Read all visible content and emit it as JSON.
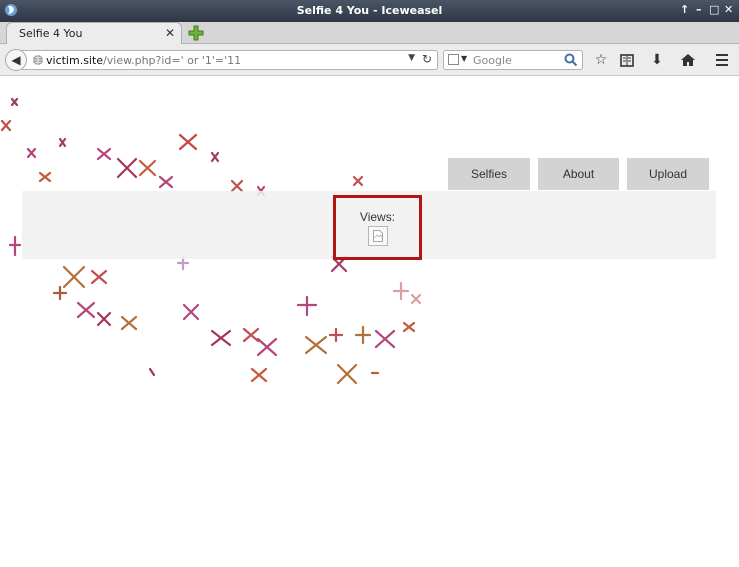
{
  "window": {
    "title": "Selfie 4 You - Iceweasel",
    "controls": [
      "↑",
      "–",
      "□",
      "✕"
    ]
  },
  "tabs": [
    {
      "label": "Selfie 4 You",
      "close_glyph": "✕"
    }
  ],
  "navbar": {
    "url_host": "victim.site",
    "url_path": "/view.php?id=' or '1'='11",
    "search_placeholder": "Google",
    "icons": [
      "back-icon",
      "globe-icon",
      "reload-icon",
      "search-engine-icon",
      "magnifier-icon",
      "star-icon",
      "reading-list-icon",
      "download-icon",
      "home-icon",
      "menu-icon"
    ]
  },
  "site": {
    "nav": [
      {
        "label": "Selfies"
      },
      {
        "label": "About"
      },
      {
        "label": "Upload"
      }
    ],
    "views_label": "Views:"
  },
  "colors": {
    "highlight_border": "#b01515",
    "nav_button_bg": "#d3d3d3",
    "titlebar_bg": "#2d3645"
  }
}
